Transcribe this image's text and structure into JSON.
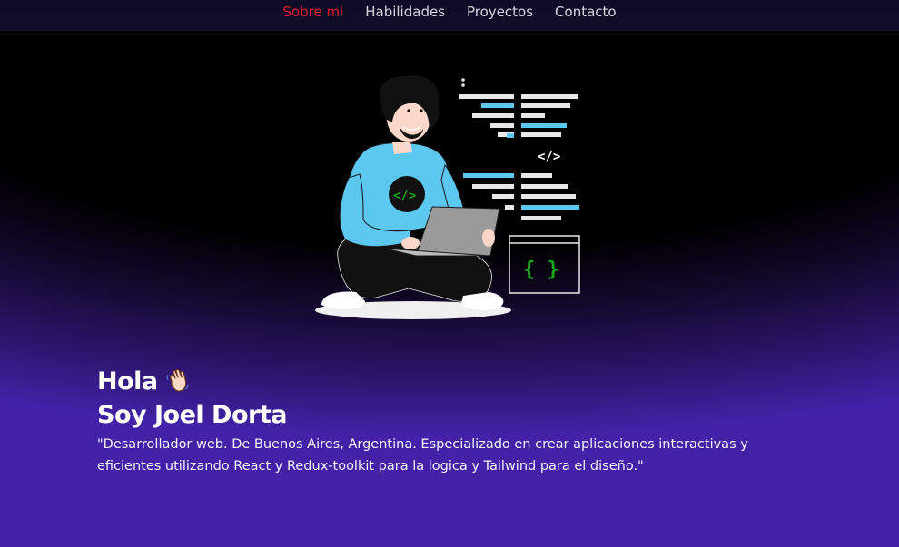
{
  "nav": {
    "items": [
      {
        "label": "Sobre mi",
        "active": true
      },
      {
        "label": "Habilidades",
        "active": false
      },
      {
        "label": "Proyectos",
        "active": false
      },
      {
        "label": "Contacto",
        "active": false
      }
    ]
  },
  "hero": {
    "illustration": {
      "code_tag": "</>",
      "braces": "{ }",
      "shirt_logo": "</>"
    },
    "greeting": "Hola",
    "greeting_icon": "waving-hand-icon",
    "name": "Soy Joel Dorta",
    "bio": "\"Desarrollador web. De Buenos Aires, Argentina. Especializado en crear aplicaciones interactivas y eficientes utilizando React y Redux-toolkit para la logica y Tailwind para el diseño.\""
  },
  "colors": {
    "active_nav": "#e0202a",
    "nav_text": "#d6d6de",
    "shirt": "#5cc8f0",
    "code_accent": "#1aa51a",
    "bg_glow": "#4322a8"
  }
}
